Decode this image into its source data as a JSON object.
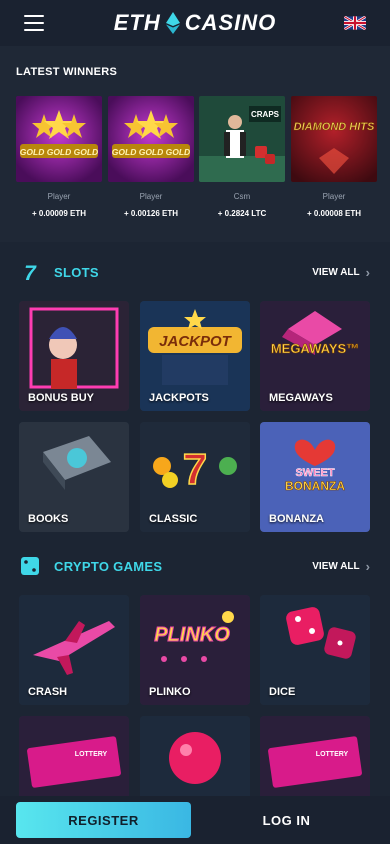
{
  "header": {
    "logo_left": "ETH",
    "logo_right": "CASINO",
    "menu_icon": "hamburger-menu-icon",
    "flag_icon": "uk-flag-icon"
  },
  "winners": {
    "title": "LATEST WINNERS",
    "items": [
      {
        "user": "Player",
        "amount": "+ 0.00009 ETH",
        "game_text": "GOLD GOLD GOLD"
      },
      {
        "user": "Player",
        "amount": "+ 0.00126 ETH",
        "game_text": "GOLD GOLD GOLD"
      },
      {
        "user": "Csm",
        "amount": "+ 0.2824 LTC",
        "game_text": "CRAPS"
      },
      {
        "user": "Player",
        "amount": "+ 0.00008 ETH",
        "game_text": "DIAMOND HITS"
      }
    ]
  },
  "slots": {
    "title": "SLOTS",
    "icon": "seven-icon",
    "view_all": "VIEW ALL",
    "cards": [
      {
        "label": "BONUS BUY"
      },
      {
        "label": "JACKPOTS",
        "art_text": "JACKPOT"
      },
      {
        "label": "MEGAWAYS",
        "art_text": "MEGAWAYS™"
      },
      {
        "label": "BOOKS"
      },
      {
        "label": "CLASSIC"
      },
      {
        "label": "BONANZA",
        "art_text_1": "SWEET",
        "art_text_2": "BONANZA"
      }
    ]
  },
  "crypto": {
    "title": "CRYPTO GAMES",
    "icon": "dice-icon",
    "view_all": "VIEW ALL",
    "cards": [
      {
        "label": "CRASH"
      },
      {
        "label": "PLINKO",
        "art_text": "PLINKO"
      },
      {
        "label": "DICE"
      },
      {
        "label": "",
        "art_text": "LOTTERY"
      },
      {
        "label": ""
      },
      {
        "label": "",
        "art_text": "LOTTERY"
      }
    ]
  },
  "footer": {
    "register": "REGISTER",
    "login": "LOG IN"
  },
  "colors": {
    "accent": "#3fd7e8",
    "background": "#1c2533"
  }
}
